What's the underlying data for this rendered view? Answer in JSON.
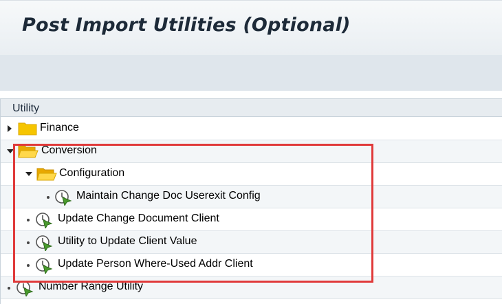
{
  "title": "Post Import Utilities (Optional)",
  "tree": {
    "header": "Utility",
    "rows": [
      {
        "label": "Finance",
        "type": "folder-collapsed"
      },
      {
        "label": "Conversion",
        "type": "folder-expanded"
      },
      {
        "label": "Configuration",
        "type": "folder-expanded"
      },
      {
        "label": "Maintain Change Doc Userexit Config",
        "type": "executable"
      },
      {
        "label": "Update Change Document Client",
        "type": "executable"
      },
      {
        "label": "Utility to Update Client Value",
        "type": "executable"
      },
      {
        "label": "Update Person Where-Used Addr Client",
        "type": "executable"
      },
      {
        "label": "Number Range Utility",
        "type": "executable"
      }
    ]
  },
  "colors": {
    "highlight_border": "#e03a3a",
    "folder": "#f6c500",
    "executable_icon": "#4a9a2e"
  }
}
